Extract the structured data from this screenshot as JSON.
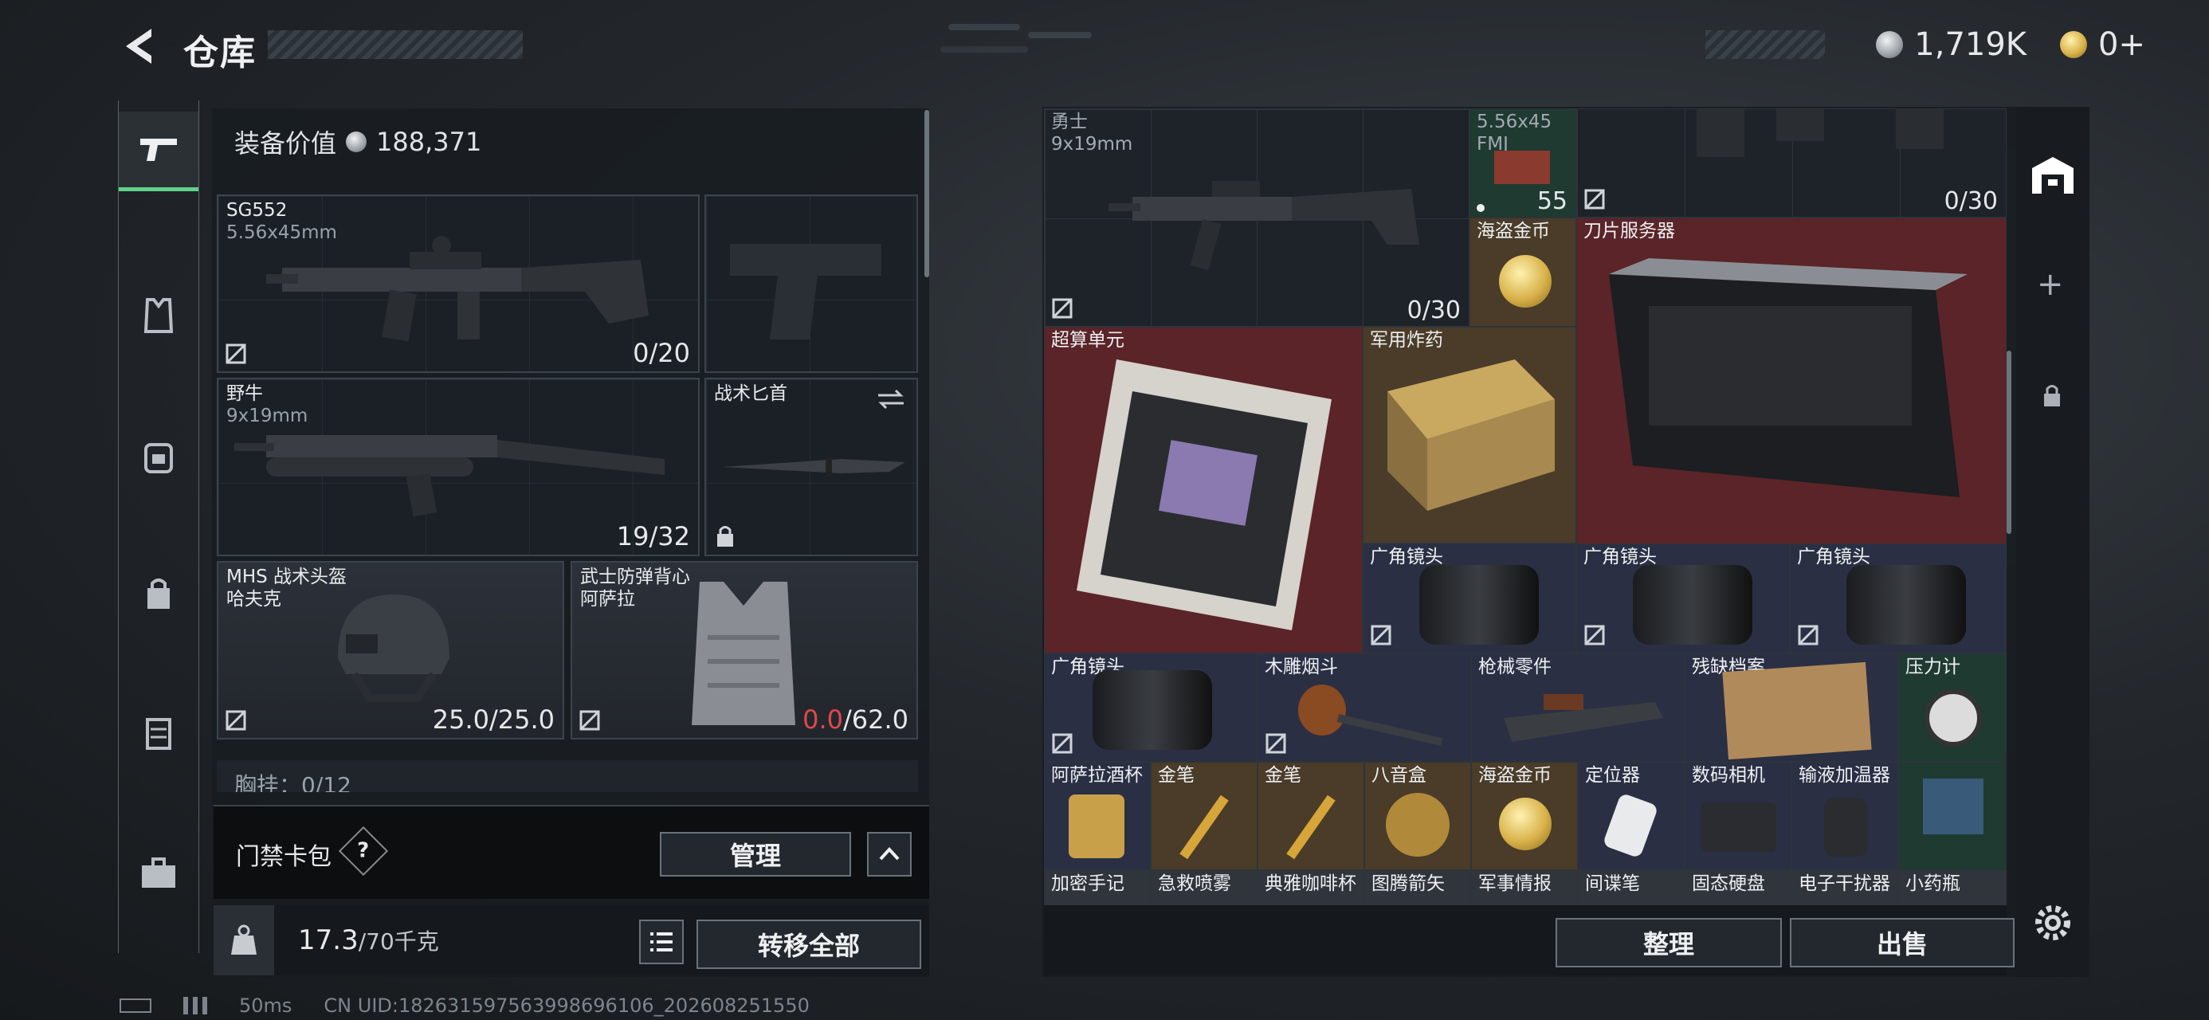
{
  "header": {
    "title": "仓库",
    "currency_silver": "1,719K",
    "currency_gold": "0+"
  },
  "nav": {
    "items": [
      "pistol-icon",
      "armor-icon",
      "backpack-icon",
      "bag-icon",
      "rig-icon",
      "case-icon"
    ]
  },
  "loadout": {
    "value_label": "装备价值",
    "value": "188,371",
    "primary": {
      "name": "SG552",
      "caliber": "5.56x45mm",
      "ammo": "0/20"
    },
    "sidearm": {
      "name": "",
      "ammo": ""
    },
    "secondary": {
      "name": "野牛",
      "caliber": "9x19mm",
      "ammo": "19/32"
    },
    "melee": {
      "name": "战术匕首"
    },
    "helmet": {
      "name": "MHS 战术头盔",
      "sub": "哈夫克",
      "durability": "25.0/25.0"
    },
    "armor": {
      "name": "武士防弹背心",
      "sub": "阿萨拉",
      "durability_current": "0.0",
      "durability_max": "/62.0"
    },
    "chest_partial": "胸挂：0/12",
    "keycard_label": "门禁卡包",
    "manage_label": "管理",
    "weight": "17.3",
    "weight_max": "/70千克",
    "transfer_all": "转移全部"
  },
  "stash": {
    "top_weapon": {
      "name": "勇士",
      "caliber": "9x19mm",
      "ammo": "0/30"
    },
    "ammo_box": {
      "name": "5.56x45",
      "sub": "FMJ",
      "count": "55"
    },
    "top_right_ammo": "0/30",
    "items": [
      {
        "label": "海盗金币"
      },
      {
        "label": "刀片服务器"
      },
      {
        "label": "超算单元"
      },
      {
        "label": "军用炸药"
      },
      {
        "label": "广角镜头"
      },
      {
        "label": "广角镜头"
      },
      {
        "label": "广角镜头"
      },
      {
        "label": "广角镜头"
      },
      {
        "label": "木雕烟斗"
      },
      {
        "label": "枪械零件"
      },
      {
        "label": "残缺档案"
      },
      {
        "label": "压力计"
      },
      {
        "label": "阿萨拉酒杯"
      },
      {
        "label": "金笔"
      },
      {
        "label": "金笔"
      },
      {
        "label": "八音盒"
      },
      {
        "label": "海盗金币"
      },
      {
        "label": "定位器"
      },
      {
        "label": "数码相机"
      },
      {
        "label": "输液加温器"
      },
      {
        "label": "加密手记"
      },
      {
        "label": "急救喷雾"
      },
      {
        "label": "典雅咖啡杯"
      },
      {
        "label": "图腾箭矢"
      },
      {
        "label": "军事情报"
      },
      {
        "label": "间谍笔"
      },
      {
        "label": "固态硬盘"
      },
      {
        "label": "电子干扰器"
      },
      {
        "label": "小药瓶"
      }
    ],
    "sort_label": "整理",
    "sell_label": "出售"
  },
  "footer": {
    "ping": "50ms",
    "uid": "CN UID:18263159756399869610​6_202608251550"
  }
}
